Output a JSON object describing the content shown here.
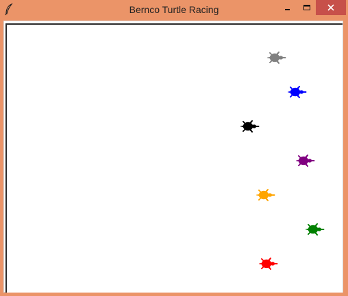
{
  "window": {
    "title": "Bernco Turtle Racing"
  },
  "icons": {
    "app": "feather-icon",
    "minimize": "minimize-icon",
    "maximize": "maximize-icon",
    "close": "close-icon"
  },
  "colors": {
    "titlebar": "#eb9468",
    "close_button": "#c7504a",
    "canvas": "#ffffff"
  },
  "turtles": [
    {
      "color": "gray",
      "fill": "#808080"
    },
    {
      "color": "blue",
      "fill": "#0000ff"
    },
    {
      "color": "black",
      "fill": "#000000"
    },
    {
      "color": "purple",
      "fill": "#800080"
    },
    {
      "color": "orange",
      "fill": "#ffa500"
    },
    {
      "color": "green",
      "fill": "#008000"
    },
    {
      "color": "red",
      "fill": "#ff0000"
    }
  ]
}
